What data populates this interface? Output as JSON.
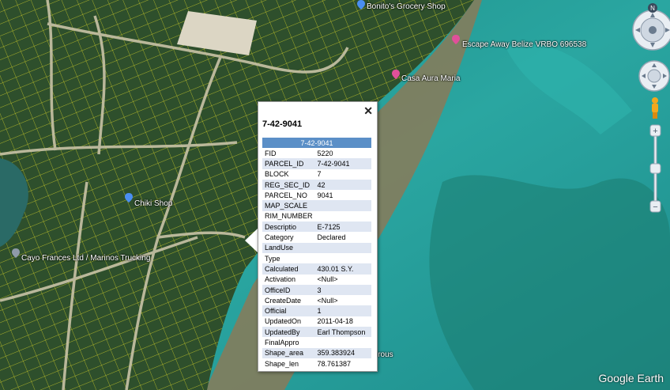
{
  "places": [
    {
      "label": "Bonito's Grocery Shop",
      "pin": "blue-pin-icon"
    },
    {
      "label": "Escape Away Belize VRBO 696538",
      "pin": "pink-pin-icon"
    },
    {
      "label": "Casa Aura Maria",
      "pin": "pink-pin-icon"
    },
    {
      "label": "Chiki Shop",
      "pin": "blue-pin-icon"
    },
    {
      "label": "Cayo Frances Ltd / Marinos Trucking",
      "pin": "gray-pin-icon"
    },
    {
      "label": "irous",
      "pin": ""
    }
  ],
  "popup": {
    "title": "7-42-9041",
    "close": "✕",
    "header": "7-42-9041",
    "rows": [
      {
        "k": "FID",
        "v": "5220"
      },
      {
        "k": "PARCEL_ID",
        "v": "7-42-9041"
      },
      {
        "k": "BLOCK",
        "v": "7"
      },
      {
        "k": "REG_SEC_ID",
        "v": "42"
      },
      {
        "k": "PARCEL_NO",
        "v": "9041"
      },
      {
        "k": "MAP_SCALE",
        "v": ""
      },
      {
        "k": "RIM_NUMBER",
        "v": ""
      },
      {
        "k": "Descriptio",
        "v": "E-7125"
      },
      {
        "k": "Category",
        "v": "Declared"
      },
      {
        "k": "LandUse",
        "v": ""
      },
      {
        "k": "Type",
        "v": ""
      },
      {
        "k": "Calculated",
        "v": "430.01 S.Y."
      },
      {
        "k": "Activation",
        "v": "<Null>"
      },
      {
        "k": "OfficeID",
        "v": "3"
      },
      {
        "k": "CreateDate",
        "v": "<Null>"
      },
      {
        "k": "Official",
        "v": "1"
      },
      {
        "k": "UpdatedOn",
        "v": "2011-04-18"
      },
      {
        "k": "UpdatedBy",
        "v": "Earl Thompson"
      },
      {
        "k": "FinalAppro",
        "v": ""
      },
      {
        "k": "Shape_area",
        "v": "359.383924"
      },
      {
        "k": "Shape_len",
        "v": "78.761387"
      }
    ]
  },
  "nav": {
    "north": "N",
    "zoom_in": "+",
    "zoom_out": "−"
  },
  "brand": "Google Earth",
  "colors": {
    "land": "#2e4f2c",
    "sea": "#2aa6a1",
    "shallow": "#1c8c8a",
    "parcel_lines": "#e5e028",
    "popup_header": "#5b8fc7"
  }
}
